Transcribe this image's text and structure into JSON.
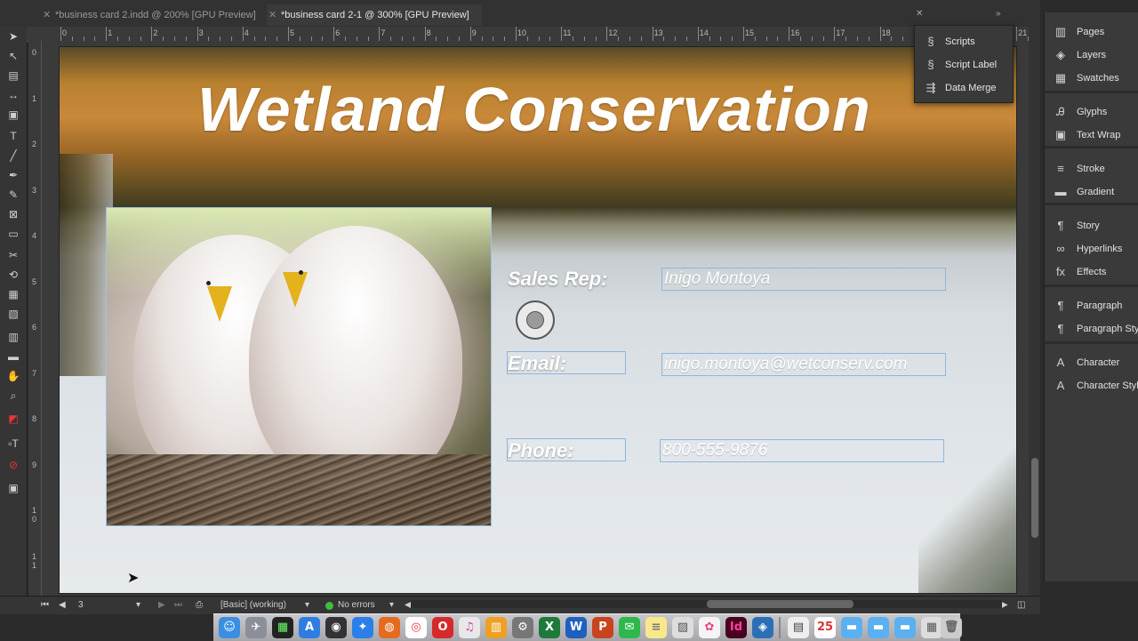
{
  "tabs": [
    {
      "label": "*business card 2.indd @ 200% [GPU Preview]",
      "active": false
    },
    {
      "label": "*business card 2-1 @ 300% [GPU Preview]",
      "active": true
    }
  ],
  "ruler": {
    "h_ticks": [
      "0",
      "1",
      "2",
      "3",
      "4",
      "5",
      "6",
      "7",
      "8",
      "9",
      "10",
      "11",
      "12",
      "13",
      "14",
      "15",
      "16",
      "17",
      "18",
      "19",
      "20",
      "21"
    ],
    "v_ticks": [
      "0",
      "1",
      "2",
      "3",
      "4",
      "5",
      "6",
      "7",
      "8",
      "9",
      "1 0",
      "1 1"
    ]
  },
  "document": {
    "headline": "Wetland Conservation",
    "fields": [
      {
        "label": "Sales Rep:",
        "value": "Inigo Montoya"
      },
      {
        "label": "Email:",
        "value": "inigo.montoya@wetconserv.com"
      },
      {
        "label": "Phone:",
        "value": "800-555-9876"
      }
    ]
  },
  "popup": {
    "items": [
      {
        "label": "Scripts",
        "icon": "scripts-icon"
      },
      {
        "label": "Script Label",
        "icon": "script-label-icon"
      },
      {
        "label": "Data Merge",
        "icon": "data-merge-icon"
      }
    ]
  },
  "panels": [
    {
      "label": "Pages",
      "icon": "pages-icon"
    },
    {
      "label": "Layers",
      "icon": "layers-icon"
    },
    {
      "label": "Swatches",
      "icon": "swatches-icon"
    },
    {
      "label": "Glyphs",
      "icon": "glyphs-icon"
    },
    {
      "label": "Text Wrap",
      "icon": "text-wrap-icon"
    },
    {
      "label": "Stroke",
      "icon": "stroke-icon"
    },
    {
      "label": "Gradient",
      "icon": "gradient-icon"
    },
    {
      "label": "Story",
      "icon": "story-icon"
    },
    {
      "label": "Hyperlinks",
      "icon": "hyperlinks-icon"
    },
    {
      "label": "Effects",
      "icon": "effects-icon"
    },
    {
      "label": "Paragraph",
      "icon": "paragraph-icon"
    },
    {
      "label": "Paragraph Styles",
      "icon": "paragraph-styles-icon"
    },
    {
      "label": "Character",
      "icon": "character-icon"
    },
    {
      "label": "Character Styles",
      "icon": "character-styles-icon"
    }
  ],
  "statusbar": {
    "page": "3",
    "style": "[Basic] (working)",
    "errors": "No errors"
  },
  "colors": {
    "selection": "#8fb5dd",
    "status_ok": "#3cbf3c",
    "indesign": "#49021f"
  }
}
